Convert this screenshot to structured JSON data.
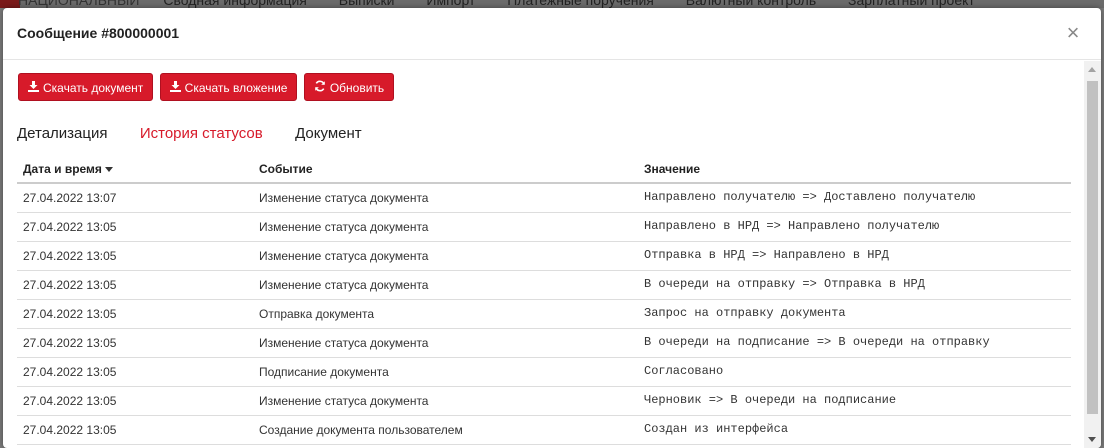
{
  "background_nav": {
    "brand": "НАЦИОНАЛЬНЫЙ",
    "items": [
      "Сводная информация",
      "Выписки",
      "Импорт",
      "Платежные поручения",
      "Валютный контроль",
      "Зарплатный проект"
    ]
  },
  "modal": {
    "title": "Сообщение #800000001",
    "close_icon": "close-icon"
  },
  "toolbar": {
    "download_document": "Скачать документ",
    "download_attachment": "Скачать вложение",
    "refresh": "Обновить"
  },
  "tabs": [
    {
      "label": "Детализация",
      "active": false
    },
    {
      "label": "История статусов",
      "active": true
    },
    {
      "label": "Документ",
      "active": false
    }
  ],
  "table": {
    "columns": [
      "Дата и время",
      "Событие",
      "Значение"
    ],
    "rows": [
      {
        "datetime": "27.04.2022 13:07",
        "event": "Изменение статуса документа",
        "value": "Направлено получателю => Доставлено получателю"
      },
      {
        "datetime": "27.04.2022 13:05",
        "event": "Изменение статуса документа",
        "value": "Направлено в НРД => Направлено получателю"
      },
      {
        "datetime": "27.04.2022 13:05",
        "event": "Изменение статуса документа",
        "value": "Отправка в НРД => Направлено в НРД"
      },
      {
        "datetime": "27.04.2022 13:05",
        "event": "Изменение статуса документа",
        "value": "В очереди на отправку => Отправка в НРД"
      },
      {
        "datetime": "27.04.2022 13:05",
        "event": "Отправка документа",
        "value": "Запрос на отправку документа"
      },
      {
        "datetime": "27.04.2022 13:05",
        "event": "Изменение статуса документа",
        "value": "В очереди на подписание => В очереди на отправку"
      },
      {
        "datetime": "27.04.2022 13:05",
        "event": "Подписание документа",
        "value": "Согласовано"
      },
      {
        "datetime": "27.04.2022 13:05",
        "event": "Изменение статуса документа",
        "value": "Черновик => В очереди на подписание"
      },
      {
        "datetime": "27.04.2022 13:05",
        "event": "Создание документа пользователем",
        "value": "Создан из интерфейса"
      }
    ]
  },
  "colors": {
    "accent": "#d71a2a"
  }
}
